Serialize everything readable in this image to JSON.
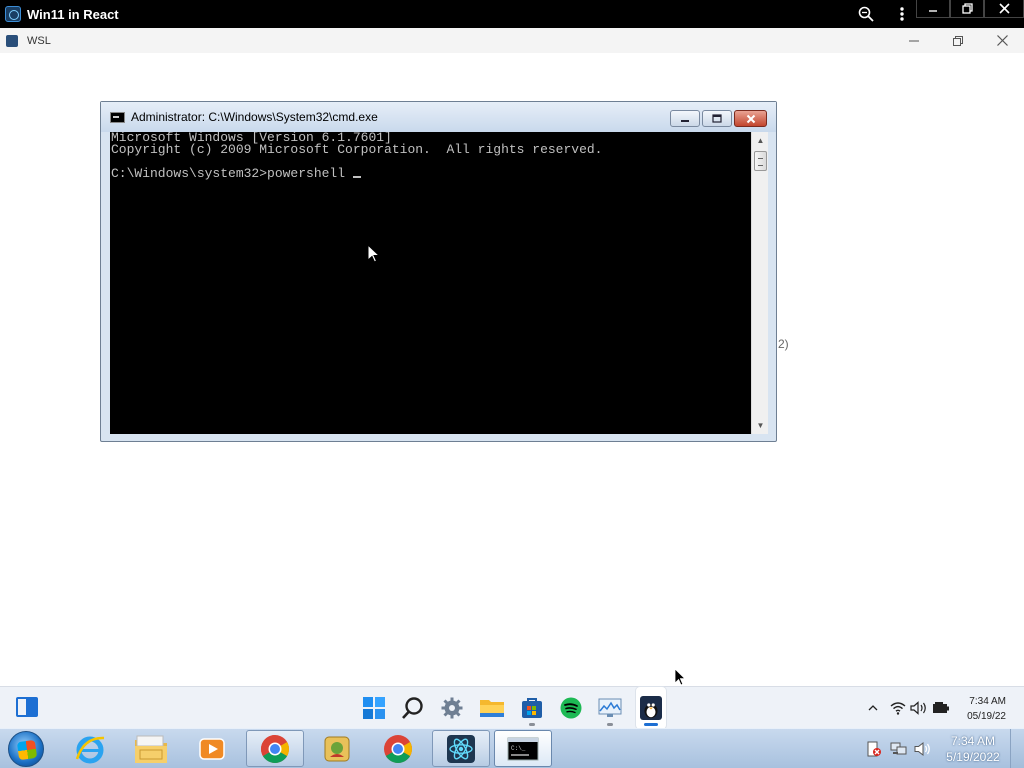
{
  "browser": {
    "title": "Win11 in React",
    "icons": [
      "zoom-icon",
      "more-vertical-icon"
    ],
    "window_buttons": [
      "minimize",
      "restore",
      "close"
    ]
  },
  "app_window": {
    "title": "WSL",
    "background_text": "2)"
  },
  "cmd": {
    "title": "Administrator: C:\\Windows\\System32\\cmd.exe",
    "lines": [
      "Microsoft Windows [Version 6.1.7601]",
      "Copyright (c) 2009 Microsoft Corporation.  All rights reserved.",
      "",
      "C:\\Windows\\system32>powershell "
    ]
  },
  "win11_taskbar": {
    "pinned": [
      "widgets-icon",
      "start-icon",
      "search-icon",
      "settings-icon",
      "file-explorer-icon",
      "store-icon",
      "spotify-icon",
      "task-manager-icon",
      "wsl-icon"
    ],
    "clock_time": "7:34 AM",
    "clock_date": "05/19/22"
  },
  "win7_taskbar": {
    "buttons": [
      "internet-explorer-icon",
      "windows-explorer-icon",
      "media-player-icon",
      "chrome-icon",
      "app-icon",
      "chrome-icon",
      "react-icon",
      "cmd-icon"
    ],
    "clock_time": "7:34 AM",
    "clock_date": "5/19/2022"
  },
  "colors": {
    "console_bg": "#000000",
    "console_text": "#c0c0c0",
    "accent": "#1d6fd3"
  }
}
